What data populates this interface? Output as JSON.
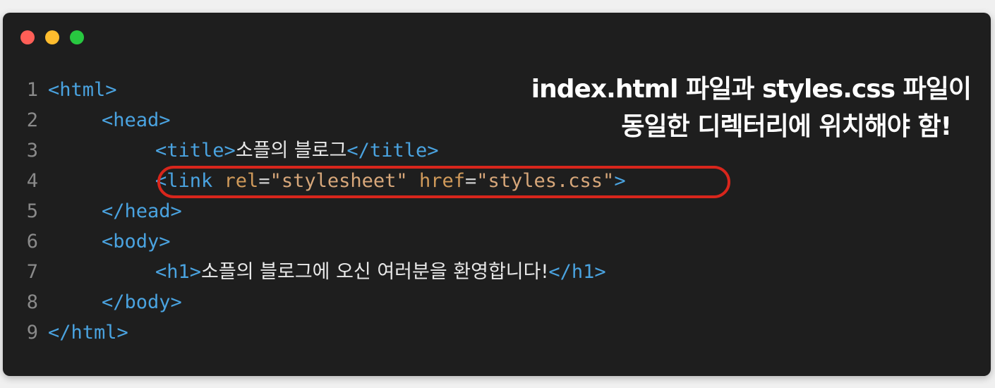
{
  "window": {
    "traffic_lights": [
      "close",
      "minimize",
      "maximize"
    ]
  },
  "code_lines": [
    {
      "n": "1",
      "open": "<html>"
    },
    {
      "n": "2",
      "open": "<head>"
    },
    {
      "n": "3",
      "open": "<title>",
      "text": "소플의 블로그",
      "close": "</title>"
    },
    {
      "n": "4",
      "tag_start": "<link",
      "attr1": "rel",
      "val1": "\"stylesheet\"",
      "attr2": "href",
      "val2": "\"styles.css\"",
      "tag_end": ">"
    },
    {
      "n": "5",
      "open": "</head>"
    },
    {
      "n": "6",
      "open": "<body>"
    },
    {
      "n": "7",
      "open": "<h1>",
      "text": "소플의 블로그에 오신 여러분을 환영합니다!",
      "close": "</h1>"
    },
    {
      "n": "8",
      "open": "</body>"
    },
    {
      "n": "9",
      "open": "</html>"
    }
  ],
  "annotation": {
    "line1": "index.html 파일과 styles.css 파일이",
    "line2": "동일한 디렉터리에 위치해야 함!"
  },
  "colors": {
    "background": "#1e1e1e",
    "tag": "#4aa3e0",
    "attribute": "#d09a5a",
    "string": "#d7a77a",
    "highlight": "#d8261c"
  }
}
